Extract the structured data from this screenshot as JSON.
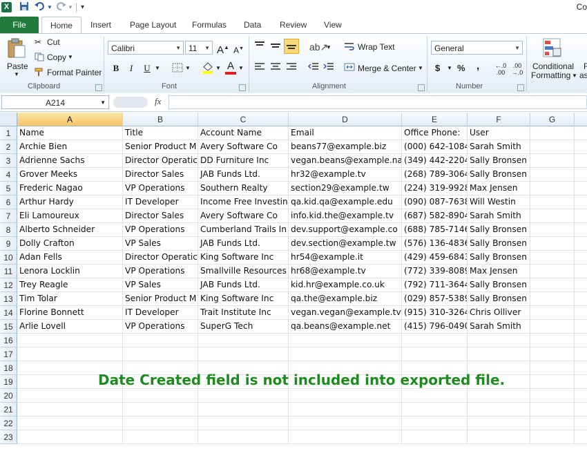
{
  "app": {
    "title_text": "Co",
    "logo_letter": "X"
  },
  "quick_access": {
    "save_icon": "save-icon",
    "undo_icon": "undo-icon",
    "redo_icon": "redo-icon",
    "customize_icon": "customize-icon"
  },
  "tabs": [
    {
      "label": "File"
    },
    {
      "label": "Home"
    },
    {
      "label": "Insert"
    },
    {
      "label": "Page Layout"
    },
    {
      "label": "Formulas"
    },
    {
      "label": "Data"
    },
    {
      "label": "Review"
    },
    {
      "label": "View"
    }
  ],
  "ribbon": {
    "clipboard": {
      "label": "Clipboard",
      "paste": "Paste",
      "cut": "Cut",
      "copy": "Copy",
      "format_painter": "Format Painter"
    },
    "font": {
      "label": "Font",
      "font_name": "Calibri",
      "font_size": "11",
      "bold": "B",
      "italic": "I",
      "underline": "U",
      "grow": "A",
      "shrink": "A",
      "font_color": "A"
    },
    "alignment": {
      "label": "Alignment",
      "wrap_text": "Wrap Text",
      "merge_center": "Merge & Center"
    },
    "number": {
      "label": "Number",
      "format": "General",
      "currency": "$",
      "percent": "%",
      "comma": ",",
      "inc_dec": "←.0 .00",
      "dec_dec": ".00 →.0"
    },
    "styles": {
      "conditional_1": "Conditional",
      "conditional_2": "Formatting",
      "format_as_1": "F",
      "format_as_2": "as"
    }
  },
  "formula_bar": {
    "name_box": "A214",
    "fx": "fx",
    "value": ""
  },
  "columns": [
    "A",
    "B",
    "C",
    "D",
    "E",
    "F",
    "G"
  ],
  "rows": [
    [
      "Name",
      "Title",
      "Account Name",
      "Email",
      "Office Phone:",
      "User",
      ""
    ],
    [
      "Archie Bien",
      "Senior Product M",
      "Avery Software Co",
      "beans77@example.biz",
      "(000) 642-1084",
      "Sarah Smith",
      ""
    ],
    [
      "Adrienne Sachs",
      "Director Operatic",
      "DD Furniture Inc",
      "vegan.beans@example.na",
      "(349) 442-2204",
      "Sally Bronsen",
      ""
    ],
    [
      "Grover Meeks",
      "Director Sales",
      "JAB Funds Ltd.",
      "hr32@example.tv",
      "(268) 789-3064",
      "Sally Bronsen",
      ""
    ],
    [
      "Frederic Nagao",
      "VP Operations",
      "Southern Realty",
      "section29@example.tw",
      "(224) 319-9928",
      "Max Jensen",
      ""
    ],
    [
      "Arthur Hardy",
      "IT Developer",
      "Income Free Investin",
      "qa.kid.qa@example.edu",
      "(090) 087-7638",
      "Will Westin",
      ""
    ],
    [
      "Eli Lamoureux",
      "Director Sales",
      "Avery Software Co",
      "info.kid.the@example.tv",
      "(687) 582-8904",
      "Sarah Smith",
      ""
    ],
    [
      "Alberto Schneider",
      "VP Operations",
      "Cumberland Trails In",
      "dev.support@example.co",
      "(688) 785-7146",
      "Sally Bronsen",
      ""
    ],
    [
      "Dolly Crafton",
      "VP Sales",
      "JAB Funds Ltd.",
      "dev.section@example.tw",
      "(576) 136-4836",
      "Sally Bronsen",
      ""
    ],
    [
      "Adan Fells",
      "Director Operatic",
      "King Software Inc",
      "hr54@example.it",
      "(429) 459-6843",
      "Sally Bronsen",
      ""
    ],
    [
      "Lenora Locklin",
      "VP Operations",
      "Smallville Resources",
      "hr68@example.tv",
      "(772) 339-8089",
      "Max Jensen",
      ""
    ],
    [
      "Trey Reagle",
      "VP Sales",
      "JAB Funds Ltd.",
      "kid.hr@example.co.uk",
      "(792) 711-3644",
      "Sally Bronsen",
      ""
    ],
    [
      "Tim Tolar",
      "Senior Product M",
      "King Software Inc",
      "qa.the@example.biz",
      "(029) 857-5389",
      "Sally Bronsen",
      ""
    ],
    [
      "Florine Bonnett",
      "IT Developer",
      "Trait Institute Inc",
      "vegan.vegan@example.tv",
      "(915) 310-3264",
      "Chris Olliver",
      ""
    ],
    [
      "Arlie Lovell",
      "VP Operations",
      "SuperG Tech",
      "qa.beans@example.net",
      "(415) 796-0490",
      "Sarah Smith",
      ""
    ],
    [
      "",
      "",
      "",
      "",
      "",
      "",
      ""
    ],
    [
      "",
      "",
      "",
      "",
      "",
      "",
      ""
    ],
    [
      "",
      "",
      "",
      "",
      "",
      "",
      ""
    ],
    [
      "",
      "",
      "",
      "",
      "",
      "",
      ""
    ],
    [
      "",
      "",
      "",
      "",
      "",
      "",
      ""
    ],
    [
      "",
      "",
      "",
      "",
      "",
      "",
      ""
    ],
    [
      "",
      "",
      "",
      "",
      "",
      "",
      ""
    ],
    [
      "",
      "",
      "",
      "",
      "",
      "",
      ""
    ]
  ],
  "note": "Date Created field is not included into exported file."
}
